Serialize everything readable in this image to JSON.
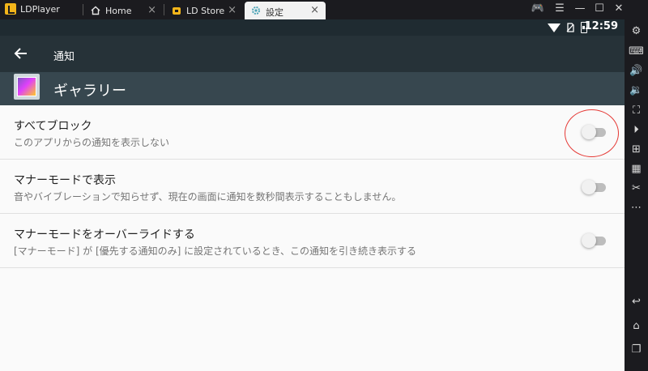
{
  "titlebar": {
    "app_name": "LDPlayer",
    "tabs": [
      {
        "label": "Home",
        "close": "×"
      },
      {
        "label": "LD Store",
        "close": "×"
      },
      {
        "label": "設定",
        "close": "×"
      }
    ],
    "controls": {
      "gamepad": "🎮",
      "menu": "☰",
      "minimize": "—",
      "maximize": "☐",
      "close": "✕"
    }
  },
  "status_bar": {
    "time": "12:59"
  },
  "app_bar": {
    "title": "通知"
  },
  "app_header": {
    "title": "ギャラリー",
    "icon": "gallery-icon"
  },
  "settings": [
    {
      "title": "すべてブロック",
      "subtitle": "このアプリからの通知を表示しない",
      "enabled": false
    },
    {
      "title": "マナーモードで表示",
      "subtitle": "音やバイブレーションで知らせず、現在の画面に通知を数秒間表示することもしません。",
      "enabled": false
    },
    {
      "title": "マナーモードをオーバーライドする",
      "subtitle": "[マナーモード] が [優先する通知のみ] に設定されているとき、この通知を引き続き表示する",
      "enabled": false
    }
  ],
  "sidebar": {
    "icons": [
      "settings-icon",
      "keyboard-icon",
      "volume-up-icon",
      "volume-down-icon",
      "screenshot-icon",
      "record-icon",
      "add-apk-icon",
      "apk-icon",
      "scissors-icon",
      "more-icon",
      "back-icon",
      "home-icon",
      "recents-icon"
    ],
    "glyphs": [
      "⚙",
      "⌨",
      "🔊",
      "🔉",
      "⛶",
      "⏵",
      "⊞",
      "▦",
      "✂",
      "⋯",
      "↩",
      "⌂",
      "❐"
    ]
  },
  "colors": {
    "toolbar": "#263238",
    "header": "#37474f",
    "highlight": "#e53935",
    "accent": "#f3b51a"
  }
}
